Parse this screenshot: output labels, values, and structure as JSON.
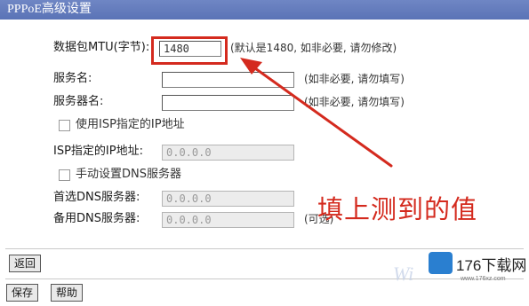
{
  "window": {
    "title": "PPPoE高级设置"
  },
  "form": {
    "mtu": {
      "label": "数据包MTU(字节):",
      "value": "1480",
      "hint": "(默认是1480, 如非必要, 请勿修改)"
    },
    "service_name": {
      "label": "服务名:",
      "value": "",
      "hint": "(如非必要, 请勿填写)"
    },
    "server_name": {
      "label": "服务器名:",
      "value": "",
      "hint": "(如非必要, 请勿填写)"
    },
    "use_isp_ip": {
      "label": "使用ISP指定的IP地址",
      "checked": false
    },
    "isp_ip": {
      "label": "ISP指定的IP地址:",
      "value": "0.0.0.0"
    },
    "manual_dns": {
      "label": "手动设置DNS服务器",
      "checked": false
    },
    "primary_dns": {
      "label": "首选DNS服务器:",
      "value": "0.0.0.0"
    },
    "secondary_dns": {
      "label": "备用DNS服务器:",
      "value": "0.0.0.0",
      "hint": "(可选)"
    }
  },
  "annotation": {
    "text": "填上测到的值",
    "color": "#d42a1e"
  },
  "buttons": {
    "back": "返回",
    "save": "保存",
    "help": "帮助"
  },
  "watermark": {
    "text": "Wi",
    "brand": "176下载网",
    "brand_url": "www.176xz.com"
  }
}
